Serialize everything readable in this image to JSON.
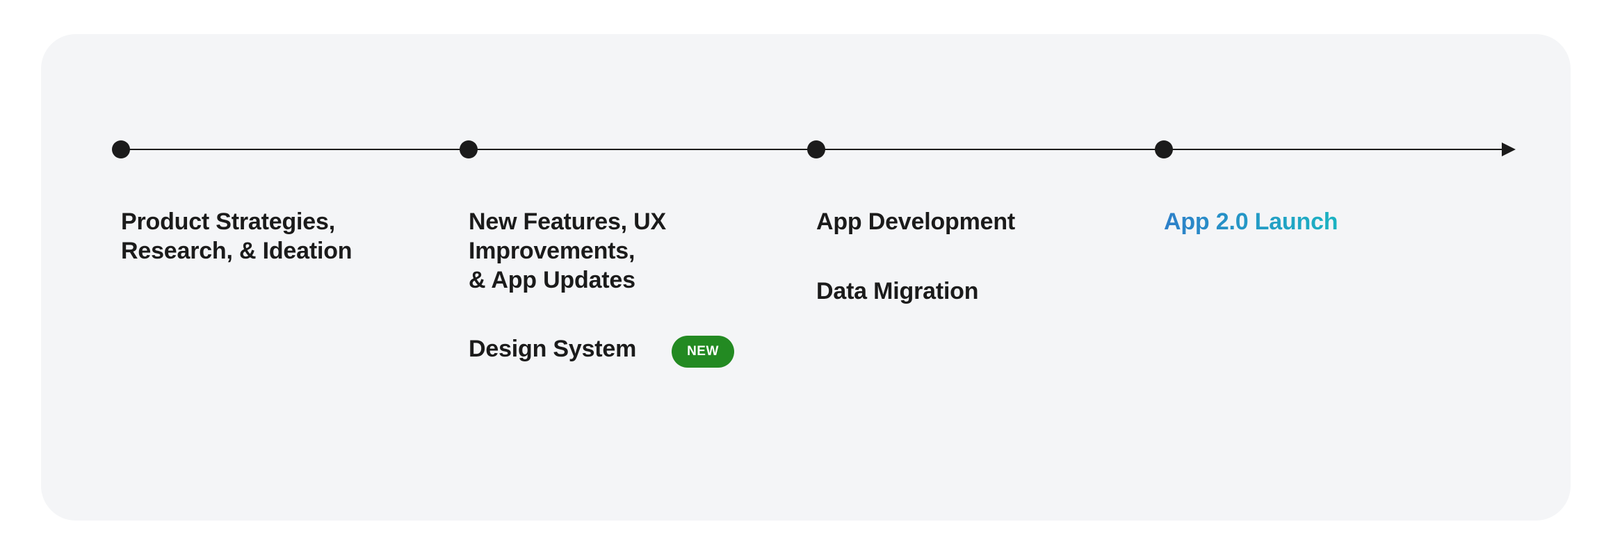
{
  "milestones": [
    {
      "title": "Product Strategies,\nResearch, & Ideation"
    },
    {
      "title": "New Features, UX\nImprovements,\n& App Updates",
      "sub_item": "Design System",
      "badge": "NEW"
    },
    {
      "title": "App Development",
      "sub_item": "Data Migration"
    },
    {
      "title": "App 2.0 Launch"
    }
  ],
  "colors": {
    "card_background": "#f4f5f7",
    "text": "#1b1b1b",
    "line": "#1b1b1b",
    "accent_gradient": [
      "#2d7fc9",
      "#1bb3c2"
    ],
    "badge": "#238a22"
  }
}
